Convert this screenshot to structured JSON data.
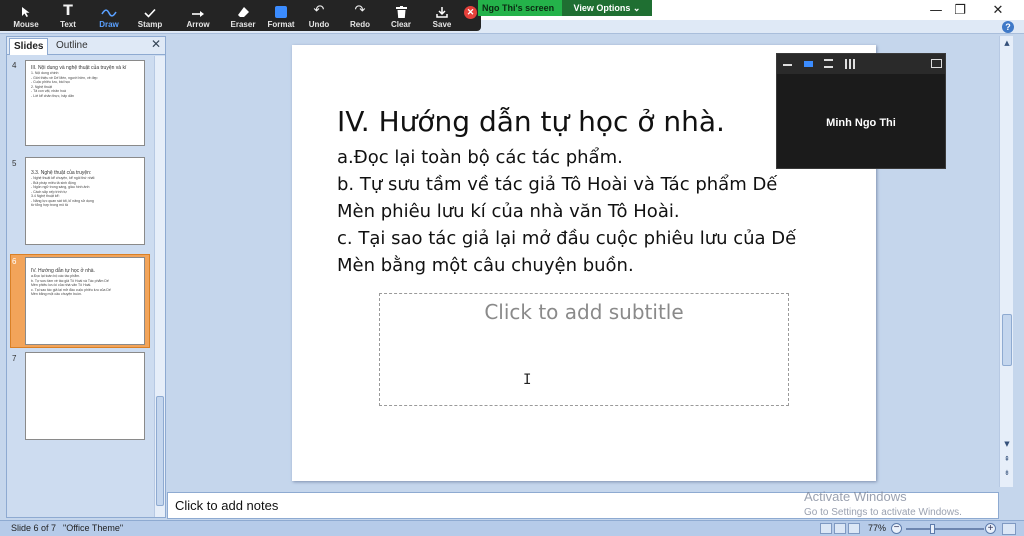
{
  "zoom_toolbar": {
    "tools": [
      {
        "label": "Mouse",
        "icon": "mouse-pointer-icon"
      },
      {
        "label": "Text",
        "icon": "text-T-icon"
      },
      {
        "label": "Draw",
        "icon": "squiggle-draw-icon",
        "active": true
      },
      {
        "label": "Stamp",
        "icon": "checkmark-stamp-icon"
      },
      {
        "label": "Arrow",
        "icon": "arrow-icon"
      },
      {
        "label": "Eraser",
        "icon": "eraser-icon"
      },
      {
        "label": "Format",
        "icon": "blue-square-format-icon"
      },
      {
        "label": "Undo",
        "icon": "undo-icon"
      },
      {
        "label": "Redo",
        "icon": "redo-icon"
      },
      {
        "label": "Clear",
        "icon": "trash-icon"
      },
      {
        "label": "Save",
        "icon": "save-download-icon"
      }
    ],
    "share_banner": "Ngo Thi's screen",
    "view_options": "View Options ⌄",
    "accent_active": "#5aa0ff",
    "close_color": "#e5403a"
  },
  "left_panel": {
    "tabs": [
      "Slides",
      "Outline"
    ],
    "thumbnails": [
      {
        "number": "4",
        "title": "III. Nội dung và nghệ thuật của truyện và kí",
        "lines": [
          "1. Nội dung chính",
          "- Giới thiệu về Dế Mèn, người hiền, vẻ đẹp",
          "- Cuộc phiêu lưu, bài học",
          "2. Nghệ thuật",
          "- Tả con vật, nhân hoá",
          "- Lời kể chân thực, hấp dẫn"
        ]
      },
      {
        "number": "5",
        "title": "3.3. Nghệ thuật của truyện:",
        "lines": [
          "- Nghệ thuật kể chuyện, kể ngôi thứ nhất",
          "- Bút pháp miêu tả sinh động",
          "- Ngôn ngữ trong sáng, giàu hình ảnh",
          "- Cách sắp xếp trình tự",
          "3.4 Nghệ thuật kể:",
          "- Năng lực quan sát tốt, kĩ năng sử dụng",
          "từ tổng hợp trong mô tả"
        ]
      },
      {
        "number": "6",
        "title": "IV. Hướng dẫn tự học ở nhà.",
        "lines": [
          "a.Đọc lại toàn bộ các tác phẩm.",
          "b. Tự sưu tầm về tác giả Tô Hoài và Tác phẩm Dế",
          "Mèn phiêu lưu kí của nhà văn Tô Hoài.",
          "c. Tại sao tác giả lại mở đầu cuộc phiêu lưu của Dế",
          "Mèn bằng một câu chuyện buồn."
        ],
        "selected": true
      },
      {
        "number": "7",
        "title": "",
        "lines": []
      }
    ],
    "selected_color": "#f2a45a"
  },
  "slide": {
    "heading": "IV. Hướng dẫn tự học ở nhà.",
    "body": [
      "a.Đọc lại toàn bộ các tác phẩm.",
      "b. Tự sưu tầm về tác giả Tô Hoài và Tác phẩm  Dế",
      "Mèn phiêu lưu kí của nhà văn Tô Hoài.",
      "c. Tại sao tác giả lại mở đầu cuộc phiêu lưu của Dế",
      "Mèn bằng một câu chuyện buồn."
    ],
    "subtitle_placeholder": "Click to add subtitle",
    "cursor_glyph": "I"
  },
  "notes": {
    "placeholder": "Click to add notes"
  },
  "video": {
    "participant": "Minh Ngo Thi"
  },
  "watermark": {
    "title": "Activate Windows",
    "subtitle": "Go to Settings to activate Windows."
  },
  "status_bar": {
    "slide_info": "Slide 6 of 7",
    "theme": "\"Office Theme\"",
    "zoom": "77%"
  },
  "window_controls": {
    "minimize": "—",
    "restore": "❐",
    "close": "✕"
  },
  "help": {
    "label": "?"
  }
}
